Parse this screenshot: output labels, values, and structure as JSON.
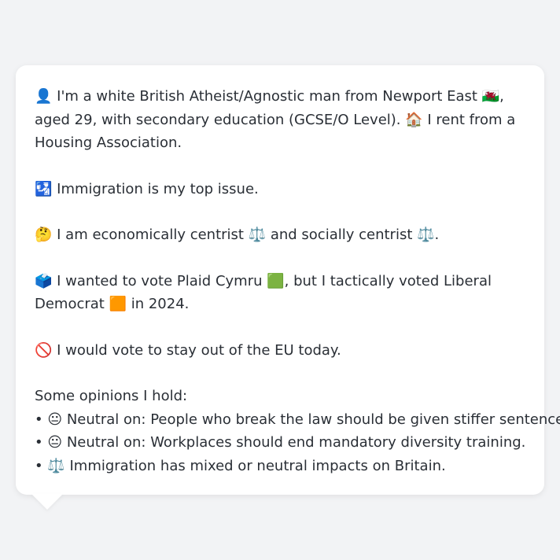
{
  "profile": {
    "intro": "👤 I'm a white British Atheist/Agnostic man from Newport East 🏴󠁧󠁢󠁷󠁬󠁳󠁿, aged 29, with secondary education (GCSE/O Level). 🏠 I rent from a Housing Association.",
    "top_issue": "🛂 Immigration is my top issue.",
    "leaning": "🤔 I am economically centrist ⚖️ and socially centrist ⚖️.",
    "vote_2024": "🗳️ I wanted to vote Plaid Cymru 🟩, but I tactically voted Liberal Democrat 🟧 in 2024.",
    "eu": "🚫 I would vote to stay out of the EU today.",
    "opinions_header": "Some opinions I hold:",
    "opinions": [
      "• 😐 Neutral on: People who break the law should be given stiffer sentences.",
      "• 😐 Neutral on: Workplaces should end mandatory diversity training.",
      "• ⚖️ Immigration has mixed or neutral impacts on Britain."
    ]
  }
}
